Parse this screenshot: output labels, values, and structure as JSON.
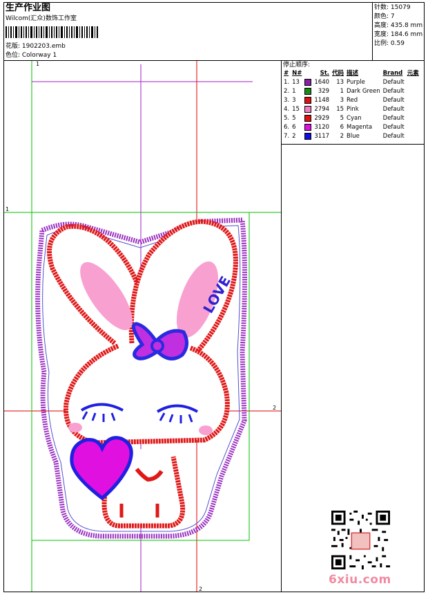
{
  "header": {
    "title": "生产作业图",
    "company": "Wilcom(汇众)数饰工作室",
    "design_label": "花版: 1902203.emb",
    "colorway_label": "色位: Colorway 1"
  },
  "stats": [
    {
      "label": "针数:",
      "value": "15079"
    },
    {
      "label": "颜色:",
      "value": "7"
    },
    {
      "label": "高度:",
      "value": "435.8 mm"
    },
    {
      "label": "宽度:",
      "value": "184.6 mm"
    },
    {
      "label": "比例:",
      "value": "0.59"
    }
  ],
  "stop_sequence": {
    "title": "停止顺序:",
    "headers": [
      "#",
      "N#",
      "St.",
      "代码",
      "描述",
      "Brand",
      "元素"
    ],
    "rows": [
      {
        "idx": "1.",
        "n": "13",
        "color": "#8a1fa8",
        "st": "1640",
        "code": "13",
        "desc": "Purple",
        "brand": "Default"
      },
      {
        "idx": "2.",
        "n": "1",
        "color": "#1a8a1a",
        "st": "329",
        "code": "1",
        "desc": "Dark Green",
        "brand": "Default"
      },
      {
        "idx": "3.",
        "n": "3",
        "color": "#e01010",
        "st": "1148",
        "code": "3",
        "desc": "Red",
        "brand": "Default"
      },
      {
        "idx": "4.",
        "n": "15",
        "color": "#f080c0",
        "st": "2794",
        "code": "15",
        "desc": "Pink",
        "brand": "Default"
      },
      {
        "idx": "5.",
        "n": "5",
        "color": "#e01010",
        "st": "2929",
        "code": "5",
        "desc": "Cyan",
        "brand": "Default"
      },
      {
        "idx": "6.",
        "n": "6",
        "color": "#e010e0",
        "st": "3120",
        "code": "6",
        "desc": "Magenta",
        "brand": "Default"
      },
      {
        "idx": "7.",
        "n": "2",
        "color": "#1010e0",
        "st": "3117",
        "code": "2",
        "desc": "Blue",
        "brand": "Default"
      }
    ]
  },
  "design": {
    "ruler_marks": [
      "1",
      "1",
      "2",
      "2"
    ],
    "bow_text": "LOVE"
  },
  "watermark": "6xiu.com"
}
